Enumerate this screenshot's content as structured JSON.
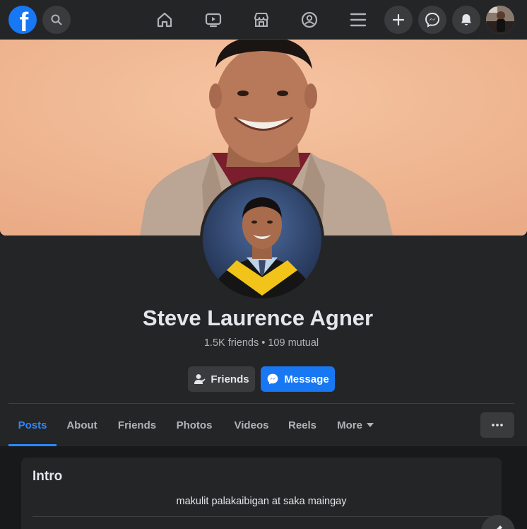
{
  "topnav": {
    "logo_letter": "f",
    "icons": [
      "facebook-logo",
      "search-icon",
      "home-icon",
      "watch-icon",
      "marketplace-icon",
      "groups-icon",
      "menu-icon",
      "create-icon",
      "messenger-icon",
      "notifications-icon",
      "account-avatar"
    ]
  },
  "profile": {
    "name": "Steve Laurence Agner",
    "stats": "1.5K friends • 109 mutual",
    "friends_button": "Friends",
    "message_button": "Message"
  },
  "tabs": [
    {
      "label": "Posts"
    },
    {
      "label": "About"
    },
    {
      "label": "Friends"
    },
    {
      "label": "Photos"
    },
    {
      "label": "Videos"
    },
    {
      "label": "Reels"
    },
    {
      "label": "More"
    }
  ],
  "intro": {
    "title": "Intro",
    "bio": "makulit palakaibigan at saka maingay"
  },
  "colors": {
    "accent": "#2d88ff",
    "brand": "#1877f2",
    "surface": "#242526",
    "background": "#18191a"
  }
}
